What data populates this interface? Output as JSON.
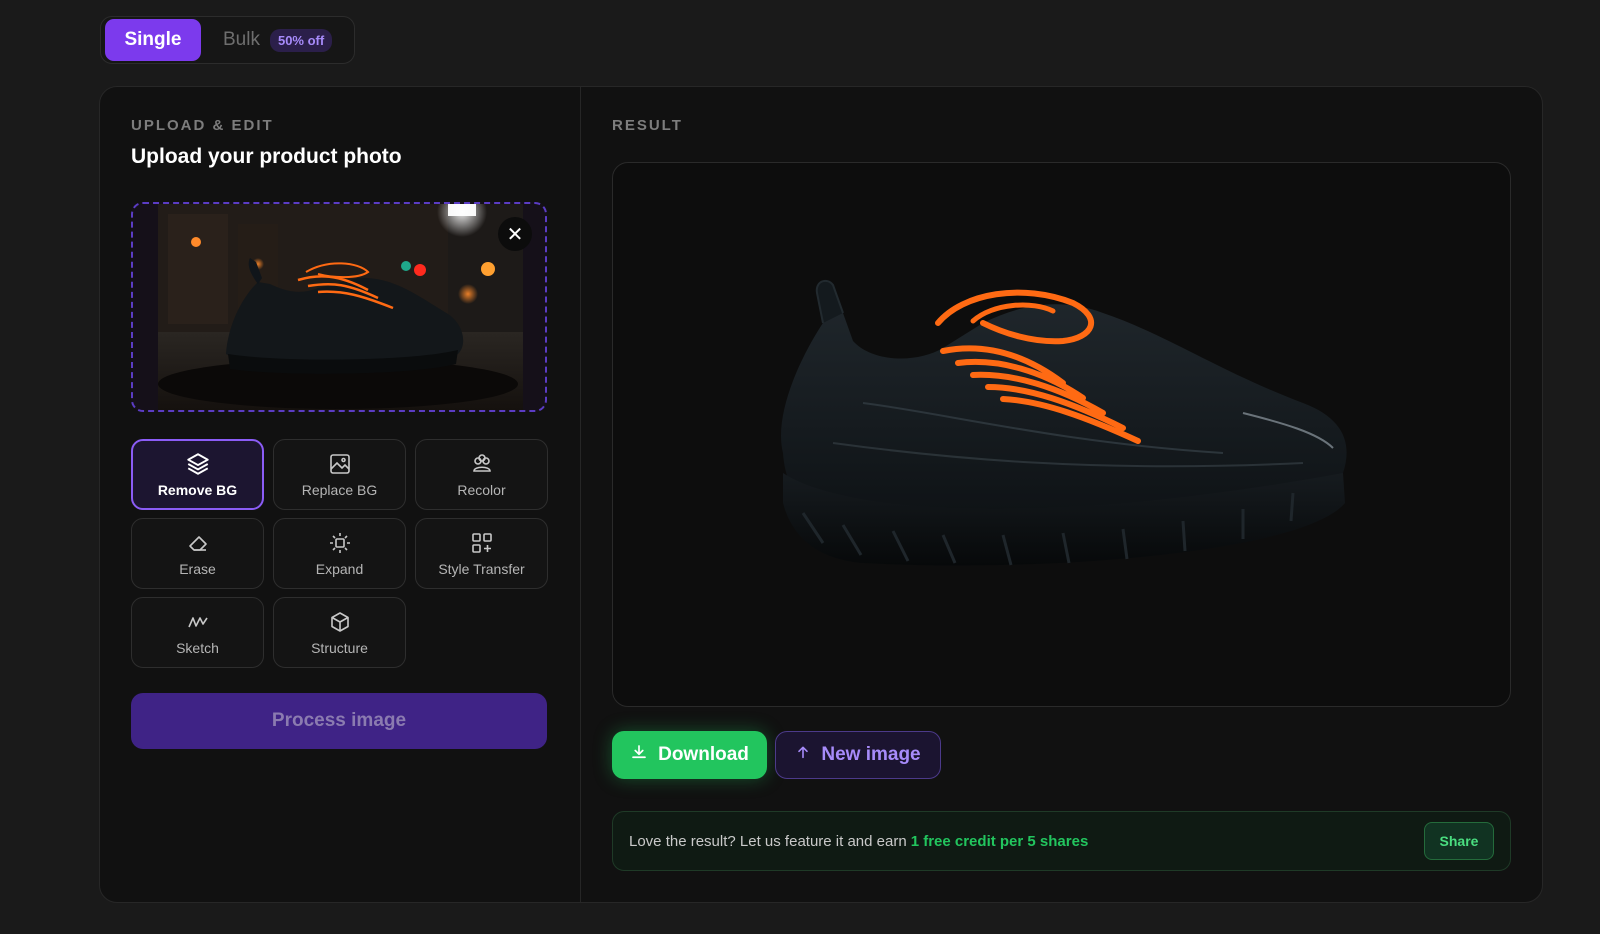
{
  "mode_switch": {
    "single_label": "Single",
    "bulk_label": "Bulk",
    "bulk_badge": "50% off"
  },
  "upload": {
    "kicker": "UPLOAD & EDIT",
    "title": "Upload your product photo",
    "photo_subject": "black sneaker with orange laces on a night street",
    "remove_icon": "close-icon"
  },
  "tools": [
    {
      "label": "Remove BG",
      "icon": "layers-icon",
      "active": true
    },
    {
      "label": "Replace BG",
      "icon": "image-icon",
      "active": false
    },
    {
      "label": "Recolor",
      "icon": "palette-icon",
      "active": false
    },
    {
      "label": "Erase",
      "icon": "eraser-icon",
      "active": false
    },
    {
      "label": "Expand",
      "icon": "expand-icon",
      "active": false
    },
    {
      "label": "Style Transfer",
      "icon": "grid-plus-icon",
      "active": false
    },
    {
      "label": "Sketch",
      "icon": "sketch-icon",
      "active": false
    },
    {
      "label": "Structure",
      "icon": "cube-icon",
      "active": false
    }
  ],
  "process_label": "Process image",
  "result": {
    "kicker": "RESULT",
    "photo_subject": "black sneaker with orange laces, background removed",
    "download_label": "Download",
    "new_image_label": "New image"
  },
  "share": {
    "text": "Love the result? Let us feature it and earn",
    "highlight": "1 free credit per 5 shares",
    "button_label": "Share"
  },
  "colors": {
    "accent": "#7c3aed",
    "success": "#22c55e",
    "background": "#1a1a1a",
    "panel": "#111111"
  }
}
